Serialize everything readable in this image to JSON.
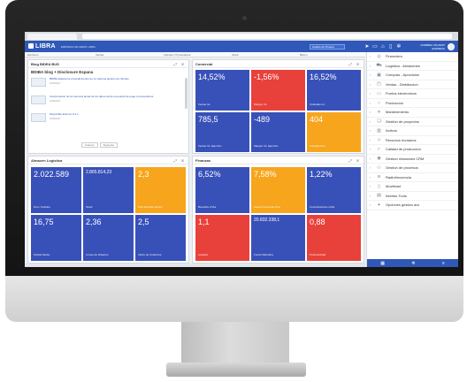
{
  "app": {
    "logo": "LIBRA",
    "subtitle": "EMPRESA DE DEMO LIBRA",
    "company": "Estado de Pinares",
    "user_name": "NOMBRE USUARIO",
    "user_role": "EMPRESA"
  },
  "subtabs": [
    "Escritorio",
    "Ventas",
    "Clientes / Proveedores",
    "Stock",
    "Banco"
  ],
  "blog": {
    "header": "Blog BIDEA BUS",
    "title": "BDIBA blog + Disclosure Espana",
    "posts": [
      {
        "text": "BDIBA adapta los procedimientos de su sistema gestion de clientes",
        "meta": "10/09/2017"
      },
      {
        "text": "Incorporacion de la memoria anual de los datos sobre el periodo de pago a proveedores",
        "meta": "10/09/2017"
      },
      {
        "text": "Disponible Entorno 6.2.1",
        "meta": "10/09/2017"
      }
    ],
    "pager": [
      "Anterior",
      "Siguiente"
    ]
  },
  "panels": {
    "general": {
      "title": "Comercial",
      "tiles": [
        {
          "value": "14,52%",
          "label": "Ventas Int.",
          "color": "#3851b8"
        },
        {
          "value": "-1,56%",
          "label": "Margen Int.",
          "color": "#e8413b"
        },
        {
          "value": "16,52%",
          "label": "Unidades Int.",
          "color": "#3851b8"
        },
        {
          "value": "785,5",
          "label": "Ventas Int. Ejercicio",
          "color": "#3851b8"
        },
        {
          "value": "-489",
          "label": "Margen Int. Ejercicio",
          "color": "#3851b8"
        },
        {
          "value": "404",
          "label": "Uds Ejercicio",
          "color": "#f7a51c"
        }
      ]
    },
    "logistics": {
      "title": "Almacen Logistica",
      "tiles": [
        {
          "value": "2.022.589",
          "label": "Num. Pedidos",
          "color": "#3851b8"
        },
        {
          "value": "2.865.814,23",
          "label": "Stock",
          "color": "#3851b8"
        },
        {
          "value": "2,3",
          "label": "Dias Entrada Ventas",
          "color": "#f7a51c"
        },
        {
          "value": "16,75",
          "label": "Pedido Medio",
          "color": "#3851b8"
        },
        {
          "value": "2,36",
          "label": "Lineas de Rotacion",
          "color": "#3851b8"
        },
        {
          "value": "2,5",
          "label": "Indice de Cobertura",
          "color": "#3851b8"
        }
      ]
    },
    "finance": {
      "title": "Finanzas",
      "tiles": [
        {
          "value": "6,52%",
          "label": "Beneficio s/Vta",
          "color": "#3851b8"
        },
        {
          "value": "7,58%",
          "label": "Gastos Personal s/Vta",
          "color": "#f7a51c"
        },
        {
          "value": "1,22%",
          "label": "Amortizaciones s/Vta",
          "color": "#3851b8"
        },
        {
          "value": "1,1",
          "label": "Liquidez",
          "color": "#e8413b"
        },
        {
          "value": "20.832.338,1",
          "label": "Fondo Maniobra",
          "color": "#3851b8"
        },
        {
          "value": "0,88",
          "label": "Productividad",
          "color": "#e8413b"
        }
      ]
    }
  },
  "sidebar": [
    {
      "label": "Financiera",
      "icon": "coin-icon"
    },
    {
      "label": "Logistica - Almacenes",
      "icon": "truck-icon"
    },
    {
      "label": "Compras - Aprovision",
      "icon": "cart-icon"
    },
    {
      "label": "Ventas - Distribucion",
      "icon": "bag-icon"
    },
    {
      "label": "Puntos electronicos",
      "icon": "monitor-icon"
    },
    {
      "label": "Produccion",
      "icon": "factory-icon"
    },
    {
      "label": "Mantenimiento",
      "icon": "wrench-icon"
    },
    {
      "label": "Gestion de proyectos",
      "icon": "project-icon"
    },
    {
      "label": "Activos",
      "icon": "building-icon"
    },
    {
      "label": "Recursos humanos",
      "icon": "people-icon"
    },
    {
      "label": "Calidad de produccion",
      "icon": "quality-icon"
    },
    {
      "label": "Gestion relaciones CRM",
      "icon": "crm-icon"
    },
    {
      "label": "Gestion de procesos",
      "icon": "process-icon"
    },
    {
      "label": "Radiofrecuencia",
      "icon": "radio-icon"
    },
    {
      "label": "Movilidad",
      "icon": "mobile-icon"
    },
    {
      "label": "Interfaz Tools",
      "icon": "tools-icon"
    },
    {
      "label": "Opciones gestion avz",
      "icon": "options-icon"
    }
  ]
}
